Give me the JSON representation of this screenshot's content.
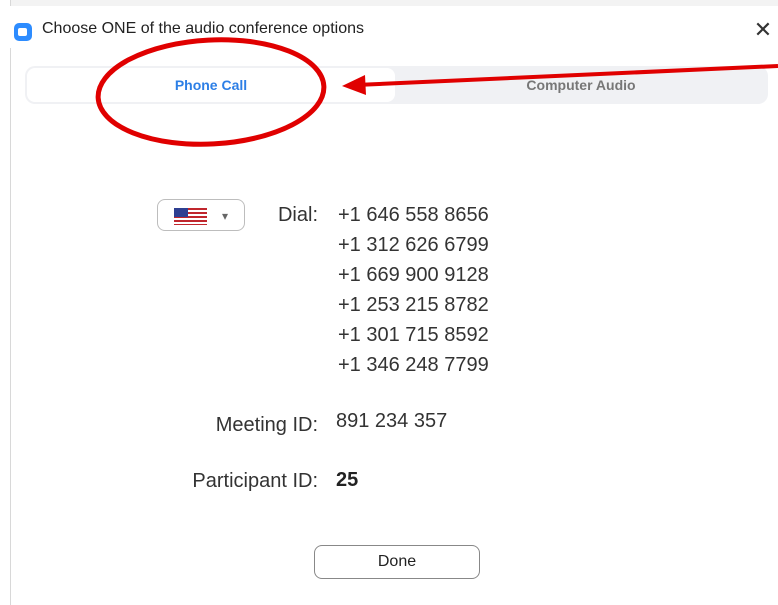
{
  "window": {
    "title": "Choose ONE of the audio conference options",
    "close_glyph": "✕",
    "icons": {
      "app": "zoom-logo-icon",
      "close": "close-icon"
    }
  },
  "tabs": [
    {
      "label": "Phone Call",
      "active": true
    },
    {
      "label": "Computer Audio",
      "active": false
    }
  ],
  "phone": {
    "country_icon": "us-flag-icon",
    "dropdown_glyph": "▾",
    "dial_label": "Dial:",
    "numbers": [
      "+1 646 558 8656",
      "+1 312 626 6799",
      "+1 669 900 9128",
      "+1 253 215 8782",
      "+1 301 715 8592",
      "+1 346 248 7799"
    ],
    "meeting_id_label": "Meeting ID:",
    "meeting_id": "891 234 357",
    "participant_id_label": "Participant ID:",
    "participant_id": "25"
  },
  "actions": {
    "done_label": "Done"
  },
  "colors": {
    "accent": "#2d7fe6",
    "annotation": "#e00000",
    "zoom_blue": "#2d8cff"
  }
}
